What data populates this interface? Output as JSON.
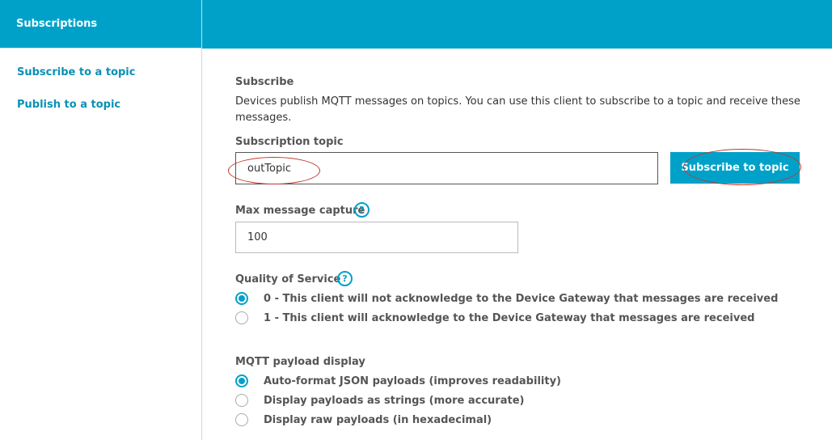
{
  "sidebar": {
    "header": "Subscriptions",
    "items": [
      {
        "label": "Subscribe to a topic"
      },
      {
        "label": "Publish to a topic"
      }
    ]
  },
  "subscribe": {
    "section_title": "Subscribe",
    "description": "Devices publish MQTT messages on topics. You can use this client to subscribe to a topic and receive these messages.",
    "topic_label": "Subscription topic",
    "topic_value": "outTopic",
    "button_label": "Subscribe to topic",
    "max_capture_label": "Max message capture",
    "max_capture_value": "100",
    "qos_label": "Quality of Service",
    "qos_options": [
      {
        "label": "0 - This client will not acknowledge to the Device Gateway that messages are received",
        "selected": true
      },
      {
        "label": "1 - This client will acknowledge to the Device Gateway that messages are received",
        "selected": false
      }
    ],
    "payload_label": "MQTT payload display",
    "payload_options": [
      {
        "label": "Auto-format JSON payloads (improves readability)",
        "selected": true
      },
      {
        "label": "Display payloads as strings (more accurate)",
        "selected": false
      },
      {
        "label": "Display raw payloads (in hexadecimal)",
        "selected": false
      }
    ],
    "help_glyph": "?"
  },
  "colors": {
    "accent": "#00a1c9",
    "link": "#0a90b5",
    "annotation": "#c0392b"
  },
  "icons": [
    "help-icon",
    "radio-button"
  ]
}
